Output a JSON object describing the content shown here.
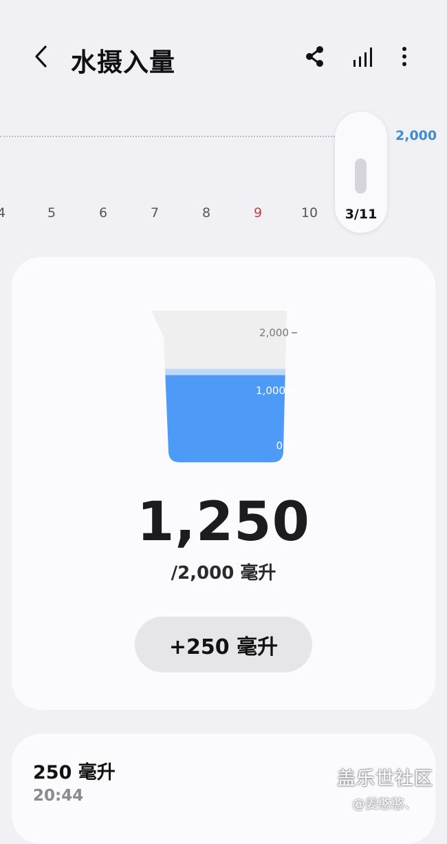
{
  "header": {
    "title": "水摄入量",
    "icons": {
      "back": "chevron-left-icon",
      "share": "share-icon",
      "stats": "bar-chart-icon",
      "more": "more-vertical-icon"
    }
  },
  "timeline": {
    "goal_label": "2,000",
    "days": [
      {
        "label": "4",
        "weekend": false
      },
      {
        "label": "5",
        "weekend": false
      },
      {
        "label": "6",
        "weekend": false
      },
      {
        "label": "7",
        "weekend": false
      },
      {
        "label": "8",
        "weekend": false
      },
      {
        "label": "9",
        "weekend": true
      },
      {
        "label": "10",
        "weekend": false
      }
    ],
    "selected_date": "3/11",
    "colors": {
      "goal": "#3f8bd2",
      "weekend": "#c0443e"
    }
  },
  "beaker": {
    "scale_labels": [
      "2,000",
      "1,000",
      "0"
    ],
    "fill_fraction": 0.625,
    "water_color": "#4d9bf7"
  },
  "summary": {
    "total": "1,250",
    "goal": "/2,000 毫升",
    "add_button": "+250 毫升"
  },
  "log": {
    "entries": [
      {
        "amount": "250 毫升",
        "time": "20:44"
      }
    ]
  },
  "watermark": {
    "site": "盖乐世社区",
    "user": "@姜憨憨、"
  }
}
